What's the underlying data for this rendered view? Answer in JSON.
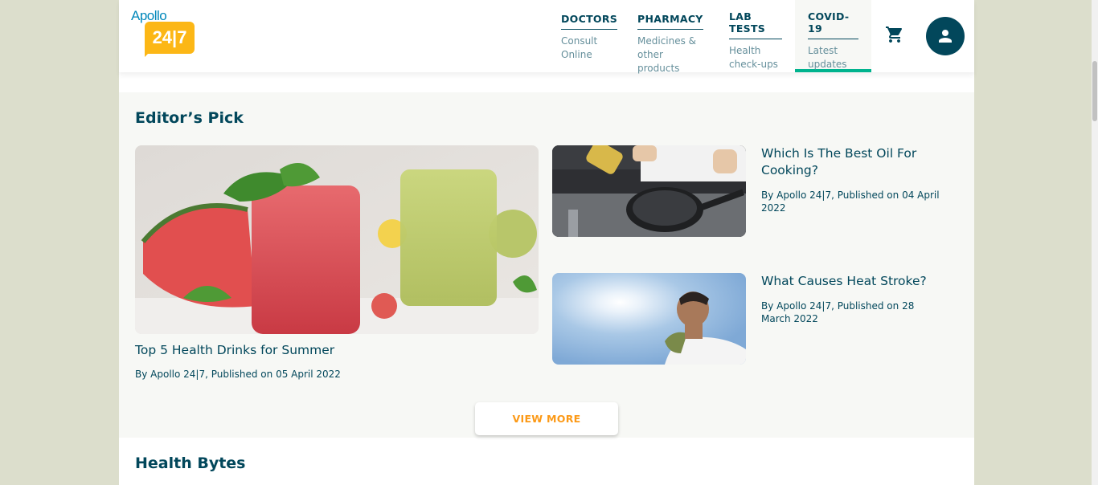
{
  "logo": {
    "text": "Apollo",
    "badge": "24|7"
  },
  "nav": [
    {
      "title": "DOCTORS",
      "sub1": "Consult",
      "sub2": "Online"
    },
    {
      "title": "PHARMACY",
      "sub1": "Medicines &",
      "sub2": "other products"
    },
    {
      "title": "LAB TESTS",
      "sub1": "Health",
      "sub2": "check-ups"
    },
    {
      "title": "COVID-19",
      "sub1": "Latest",
      "sub2": "updates"
    }
  ],
  "icons": {
    "cart": "cart-icon",
    "avatar": "user-icon"
  },
  "editors_pick": {
    "title": "Editor’s Pick",
    "main": {
      "title": "Top 5 Health Drinks for Summer",
      "meta": "By Apollo 24|7, Published on 05 April 2022"
    },
    "side": [
      {
        "title": "Which Is The Best Oil For Cooking?",
        "meta": "By Apollo 24|7, Published on 04 April 2022"
      },
      {
        "title": "What Causes Heat Stroke?",
        "meta": "By Apollo 24|7, Published on 28 March 2022"
      }
    ],
    "view_more": "VIEW MORE"
  },
  "health_bytes": {
    "title": "Health Bytes"
  },
  "colors": {
    "primary": "#02475b",
    "accent": "#fc9916",
    "active": "#00b38e",
    "logo_yellow": "#fcb716"
  }
}
